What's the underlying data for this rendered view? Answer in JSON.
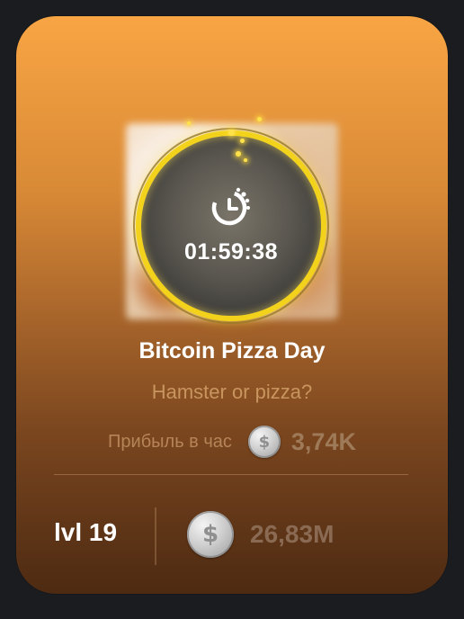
{
  "event": {
    "timer": "01:59:38",
    "title": "Bitcoin Pizza Day",
    "subtitle": "Hamster or pizza?"
  },
  "profit": {
    "label": "Прибыль в час",
    "value": "3,74K",
    "icon": "coin-icon"
  },
  "footer": {
    "level": "lvl 19",
    "balance": "26,83M",
    "icon": "coin-icon"
  },
  "icons": {
    "timer": "timer-clock-icon",
    "coin_symbol": "$"
  },
  "colors": {
    "accent_ring": "#f2d21a",
    "card_top": "#f8a544",
    "card_bottom": "#4d2a12"
  }
}
